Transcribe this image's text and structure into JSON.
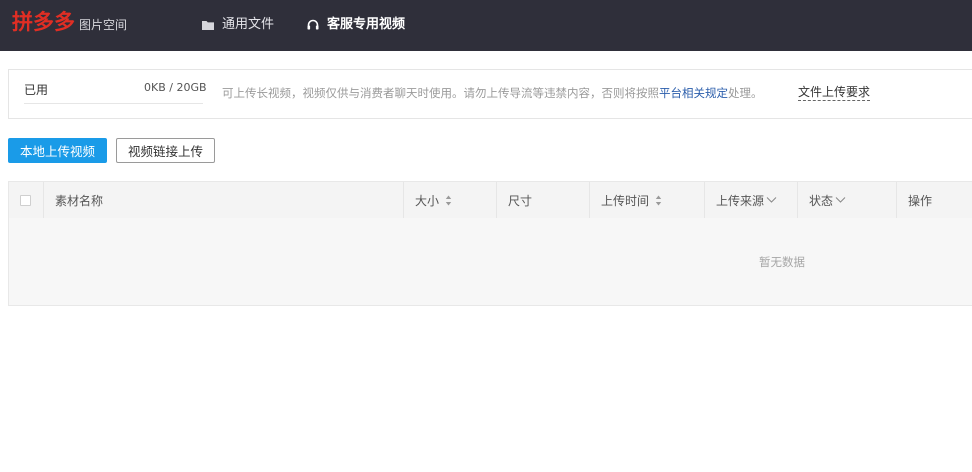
{
  "header": {
    "logo_text": "拼多多",
    "subtitle": "图片空间",
    "nav": [
      {
        "label": "通用文件",
        "icon": "folder-icon"
      },
      {
        "label": "客服专用视频",
        "icon": "headset-icon"
      }
    ],
    "colors": {
      "bar": "#2f2f3a",
      "logo": "#e02e24"
    }
  },
  "usage": {
    "label": "已用",
    "value": "0KB / 20GB",
    "notice_prefix": "可上传长视频，视频仅供与消费者聊天时使用。请勿上传导流等违禁内容，否则将按照",
    "notice_link": "平台相关规定",
    "notice_suffix": "处理。",
    "requirements_link": "文件上传要求"
  },
  "actions": {
    "local_upload": "本地上传视频",
    "link_upload": "视频链接上传"
  },
  "table": {
    "columns": [
      {
        "label": "素材名称"
      },
      {
        "label": "大小",
        "sortable": true
      },
      {
        "label": "尺寸"
      },
      {
        "label": "上传时间",
        "sortable": true
      },
      {
        "label": "上传来源",
        "filter": true
      },
      {
        "label": "状态",
        "filter": true
      },
      {
        "label": "操作"
      }
    ],
    "empty_text": "暂无数据"
  },
  "accent": "#1a9be8"
}
